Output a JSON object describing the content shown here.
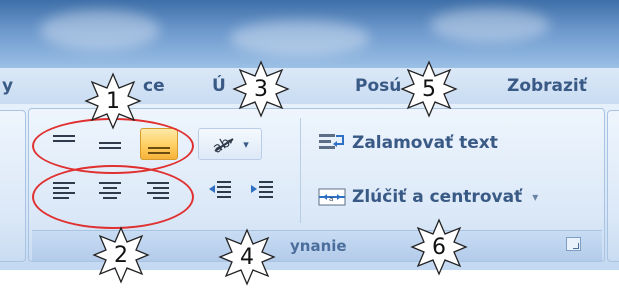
{
  "tabs": {
    "partial_left": "y",
    "insert_partial": "ce",
    "page_partial": "Ú",
    "formulas_partial": "Posú",
    "view": "Zobraziť"
  },
  "alignment_group": {
    "label": "ynanie",
    "wrap_text_label": "Zalamovať text",
    "merge_center_label": "Zlúčiť a centrovať",
    "dropdown_arrow": "▾",
    "orientation_dropdown": "▾"
  },
  "callouts": [
    "1",
    "2",
    "3",
    "4",
    "5",
    "6"
  ],
  "colors": {
    "highlight": "#ffcf62",
    "annotation_red": "#e03030",
    "ribbon_text": "#3a5a86"
  },
  "icons": {
    "top_align": "align-top-icon",
    "middle_align": "align-middle-icon",
    "bottom_align": "align-bottom-icon",
    "orientation": "text-orientation-icon",
    "left_align": "align-left-icon",
    "center_align": "align-center-icon",
    "right_align": "align-right-icon",
    "decrease_indent": "decrease-indent-icon",
    "increase_indent": "increase-indent-icon",
    "wrap_text": "wrap-text-icon",
    "merge_center": "merge-center-icon"
  }
}
